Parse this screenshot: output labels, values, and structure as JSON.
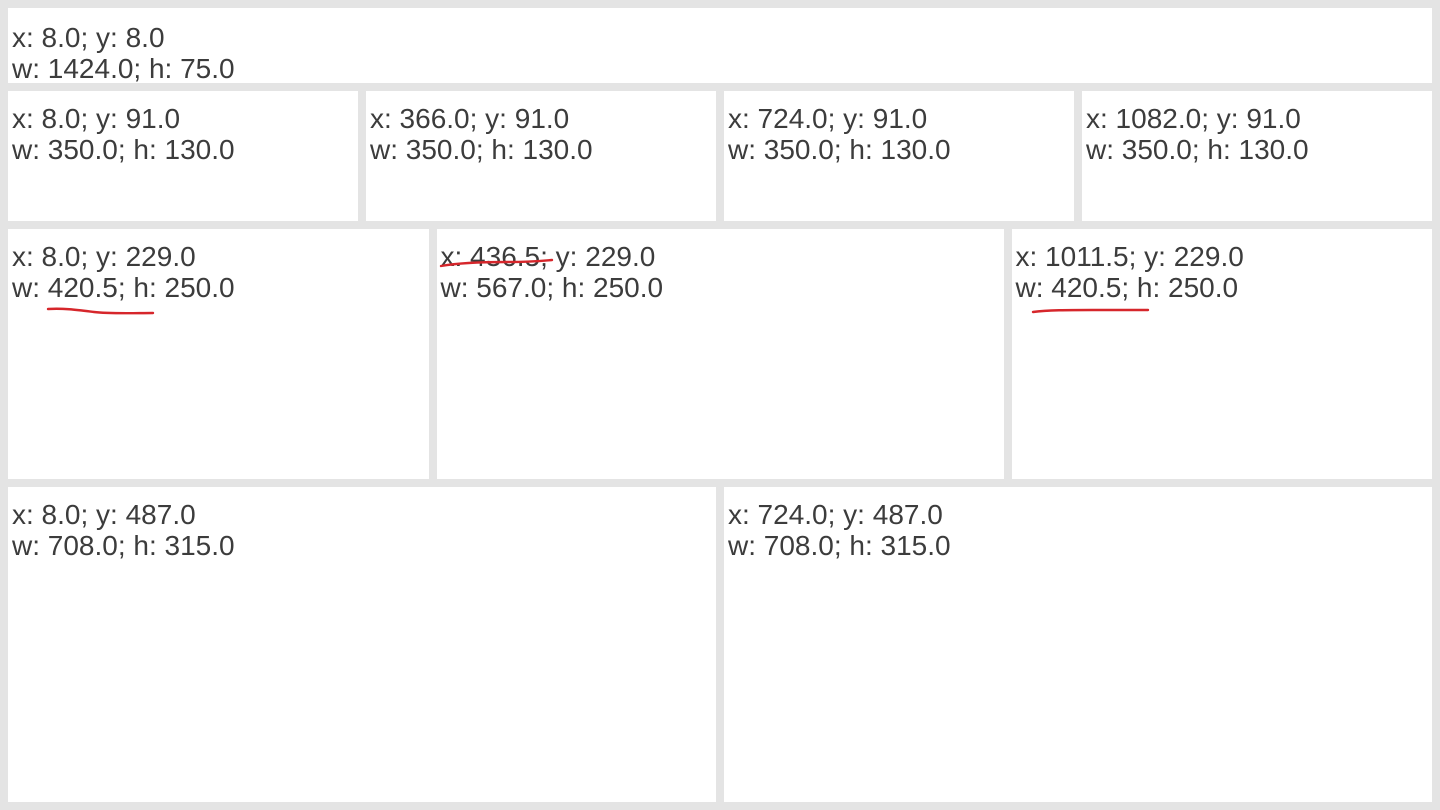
{
  "panels": [
    {
      "id": "header",
      "line1": "x: 8.0; y: 8.0",
      "line2": "w: 1424.0; h: 75.0"
    },
    {
      "id": "card-1",
      "line1": "x: 8.0; y: 91.0",
      "line2": "w: 350.0; h: 130.0"
    },
    {
      "id": "card-2",
      "line1": "x: 366.0; y: 91.0",
      "line2": "w: 350.0; h: 130.0"
    },
    {
      "id": "card-3",
      "line1": "x: 724.0; y: 91.0",
      "line2": "w: 350.0; h: 130.0"
    },
    {
      "id": "card-4",
      "line1": "x: 1082.0; y: 91.0",
      "line2": "w: 350.0; h: 130.0"
    },
    {
      "id": "middle-left",
      "line1": "x: 8.0; y: 229.0",
      "line2": "w: 420.5; h: 250.0"
    },
    {
      "id": "middle-center",
      "line1": "x: 436.5; y: 229.0",
      "line2": "w: 567.0; h: 250.0"
    },
    {
      "id": "middle-right",
      "line1": "x: 1011.5; y: 229.0",
      "line2": "w: 420.5; h: 250.0"
    },
    {
      "id": "bottom-left",
      "line1": "x: 8.0; y: 487.0",
      "line2": "w: 708.0; h: 315.0"
    },
    {
      "id": "bottom-right",
      "line1": "x: 724.0; y: 487.0",
      "line2": "w: 708.0; h: 315.0"
    }
  ],
  "colors": {
    "background": "#e4e4e4",
    "panel": "#ffffff",
    "text": "#3c3c3c",
    "annotation": "#d6262b"
  }
}
